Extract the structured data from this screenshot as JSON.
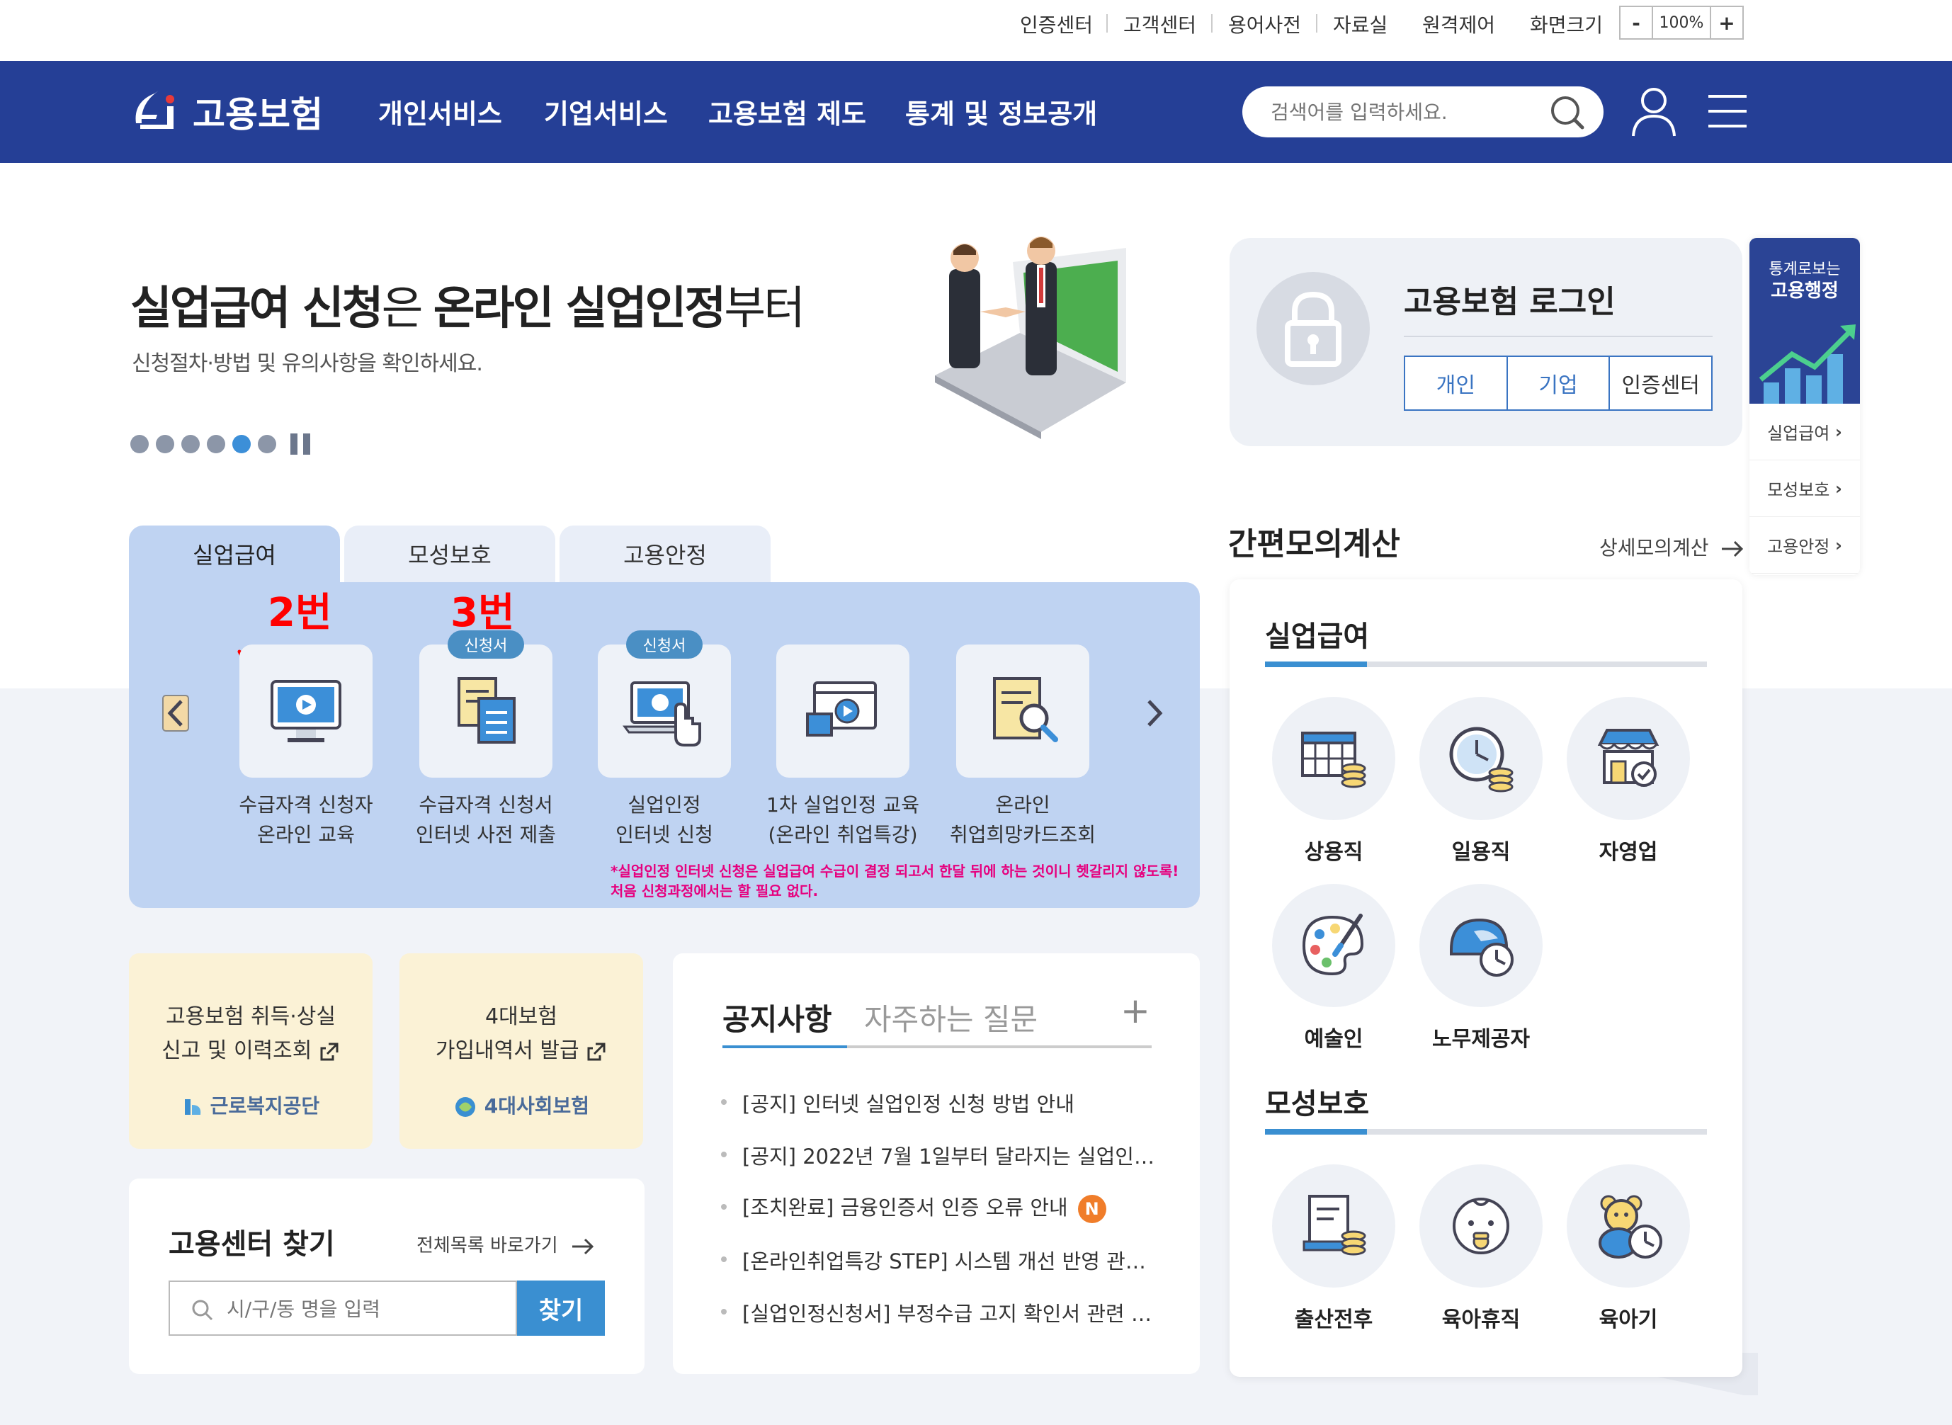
{
  "util_nav": {
    "links": [
      "인증센터",
      "고객센터",
      "용어사전",
      "자료실",
      "원격제어",
      "화면크기"
    ],
    "zoom_minus": "-",
    "zoom_value": "100%",
    "zoom_plus": "+"
  },
  "header": {
    "logo_text": "고용보험",
    "nav": [
      "개인서비스",
      "기업서비스",
      "고용보험 제도",
      "통계 및 정보공개"
    ],
    "search_placeholder": "검색어를 입력하세요."
  },
  "hero": {
    "title_bold1": "실업급여 신청",
    "title_light1": "은 ",
    "title_bold2": "온라인 실업인정",
    "title_light2": "부터",
    "subtitle": "신청절차·방법 및 유의사항을 확인하세요."
  },
  "tabs": [
    "실업급여",
    "모성보호",
    "고용안정"
  ],
  "services": [
    {
      "line1": "수급자격 신청자",
      "line2": "온라인 교육"
    },
    {
      "line1": "수급자격 신청서",
      "line2": "인터넷 사전 제출"
    },
    {
      "line1": "실업인정",
      "line2": "인터넷 신청"
    },
    {
      "line1": "1차 실업인정 교육",
      "line2": "(온라인 취업특강)"
    },
    {
      "line1": "온라인",
      "line2": "취업희망카드조회"
    }
  ],
  "badge_label": "신청서",
  "annotations": {
    "num2": "2번",
    "num3": "3번"
  },
  "notice_red": {
    "line1": "*실업인정 인터넷 신청은 실업급여 수급이 결정 되고서 한달 뒤에 하는 것이니 헷갈리지 않도록!",
    "line2": "처음 신청과정에서는 할 필요 없다."
  },
  "quick_cards": [
    {
      "line1": "고용보험 취득·상실",
      "line2": "신고 및 이력조회",
      "org": "근로복지공단"
    },
    {
      "line1": "4대보험",
      "line2": "가입내역서 발급",
      "org": "4대사회보험"
    }
  ],
  "center": {
    "title": "고용센터 찾기",
    "all_link": "전체목록 바로가기",
    "placeholder": "시/구/동 명을 입력",
    "button": "찾기"
  },
  "notices": {
    "tab_active": "공지사항",
    "tab_inactive": "자주하는 질문",
    "more": "+",
    "items": [
      "[공지] 인터넷 실업인정 신청 방법 안내",
      "[공지] 2022년 7월 1일부터 달라지는 실업인…",
      "[조치완료] 금융인증서 인증 오류 안내",
      "[온라인취업특강 STEP] 시스템 개선 반영 관…",
      "[실업인정신청서] 부정수급 고지 확인서 관련 …"
    ],
    "new_badge": "N"
  },
  "login": {
    "title": "고용보험 로그인",
    "buttons": [
      "개인",
      "기업",
      "인증센터"
    ]
  },
  "stat_box": {
    "line1": "통계로보는",
    "line2": "고용행정",
    "items": [
      "실업급여",
      "모성보호",
      "고용안정"
    ]
  },
  "calc": {
    "title": "간편모의계산",
    "detail": "상세모의계산",
    "section1": "실업급여",
    "items1": [
      "상용직",
      "일용직",
      "자영업",
      "예술인",
      "노무제공자"
    ],
    "section2": "모성보호",
    "items2": [
      "출산전후",
      "육아휴직",
      "육아기"
    ]
  },
  "colors": {
    "header_bg": "#253f96",
    "panel_bg": "#bfd3f2",
    "accent_blue": "#3a8fd1",
    "annotation_red": "#ff0000",
    "notice_pink": "#e6007e",
    "yellow_card": "#fbf2d6"
  }
}
